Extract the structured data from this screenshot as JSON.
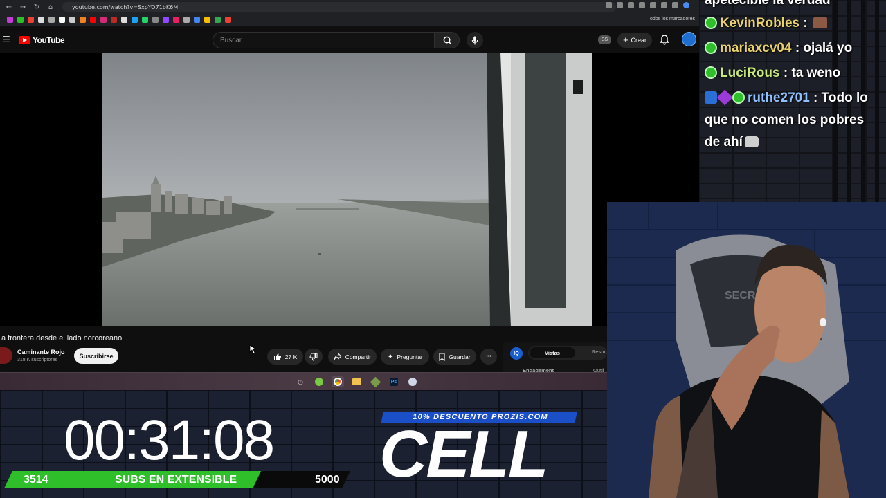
{
  "browser": {
    "url": "youtube.com/watch?v=SxpYO71bK6M",
    "bookmarks_label": "Todos los marcadores"
  },
  "youtube": {
    "logo_text": "YouTube",
    "search_placeholder": "Buscar",
    "ss_badge": "SS",
    "create_label": "Crear",
    "video_title": "a frontera desde el lado norcoreano",
    "channel_name": "Caminante Rojo",
    "channel_subs": "318 K suscriptores",
    "subscribe_label": "Suscribirse",
    "likes": "27 K",
    "share_label": "Compartir",
    "ask_label": "Preguntar",
    "save_label": "Guardar",
    "more_label": "•••"
  },
  "iq_panel": {
    "badge": "IQ",
    "tab_active": "Vistas",
    "tab_other": "Resum",
    "sub_left": "Engagement",
    "sub_right": "Outli"
  },
  "overlay": {
    "timer": "00:31:08",
    "subs_count": "3514",
    "subs_label": "SUBS EN EXTENSIBLE",
    "subs_goal": "5000",
    "subs_progress": 0.7028,
    "promo_text": "10% DESCUENTO PROZIS.COM",
    "brand": "CELL"
  },
  "chat": {
    "top_fragment": "apetecible la verdad",
    "messages": [
      {
        "user": "KevinRobles",
        "text": " : "
      },
      {
        "user": "mariaxcv04",
        "text": " : ojalá yo"
      },
      {
        "user": "LuciRous",
        "text": " : ta weno"
      },
      {
        "user": "ruthe2701",
        "text": " : Todo lo"
      }
    ],
    "continuation_1": "que no comen los pobres",
    "continuation_2": "de ahí"
  },
  "colors": {
    "youtube_red": "#ff0000",
    "subs_green": "#2fbf2a",
    "promo_blue": "#1a4fc7"
  }
}
